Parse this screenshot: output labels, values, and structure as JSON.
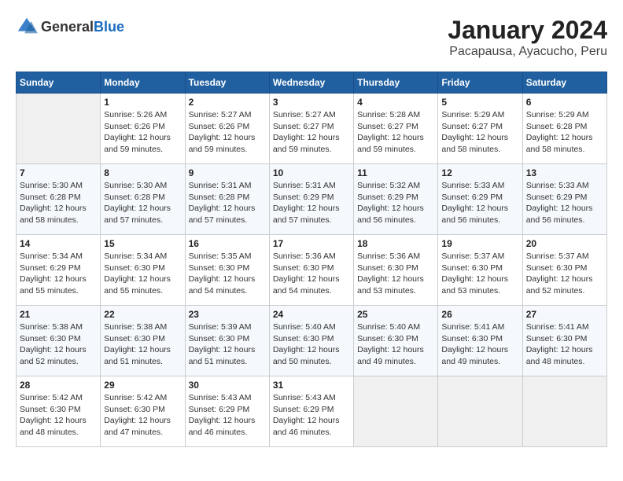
{
  "header": {
    "logo_general": "General",
    "logo_blue": "Blue",
    "title": "January 2024",
    "location": "Pacapausa, Ayacucho, Peru"
  },
  "weekdays": [
    "Sunday",
    "Monday",
    "Tuesday",
    "Wednesday",
    "Thursday",
    "Friday",
    "Saturday"
  ],
  "weeks": [
    [
      {
        "day": "",
        "empty": true
      },
      {
        "day": "1",
        "sunrise": "Sunrise: 5:26 AM",
        "sunset": "Sunset: 6:26 PM",
        "daylight": "Daylight: 12 hours and 59 minutes."
      },
      {
        "day": "2",
        "sunrise": "Sunrise: 5:27 AM",
        "sunset": "Sunset: 6:26 PM",
        "daylight": "Daylight: 12 hours and 59 minutes."
      },
      {
        "day": "3",
        "sunrise": "Sunrise: 5:27 AM",
        "sunset": "Sunset: 6:27 PM",
        "daylight": "Daylight: 12 hours and 59 minutes."
      },
      {
        "day": "4",
        "sunrise": "Sunrise: 5:28 AM",
        "sunset": "Sunset: 6:27 PM",
        "daylight": "Daylight: 12 hours and 59 minutes."
      },
      {
        "day": "5",
        "sunrise": "Sunrise: 5:29 AM",
        "sunset": "Sunset: 6:27 PM",
        "daylight": "Daylight: 12 hours and 58 minutes."
      },
      {
        "day": "6",
        "sunrise": "Sunrise: 5:29 AM",
        "sunset": "Sunset: 6:28 PM",
        "daylight": "Daylight: 12 hours and 58 minutes."
      }
    ],
    [
      {
        "day": "7",
        "sunrise": "Sunrise: 5:30 AM",
        "sunset": "Sunset: 6:28 PM",
        "daylight": "Daylight: 12 hours and 58 minutes."
      },
      {
        "day": "8",
        "sunrise": "Sunrise: 5:30 AM",
        "sunset": "Sunset: 6:28 PM",
        "daylight": "Daylight: 12 hours and 57 minutes."
      },
      {
        "day": "9",
        "sunrise": "Sunrise: 5:31 AM",
        "sunset": "Sunset: 6:28 PM",
        "daylight": "Daylight: 12 hours and 57 minutes."
      },
      {
        "day": "10",
        "sunrise": "Sunrise: 5:31 AM",
        "sunset": "Sunset: 6:29 PM",
        "daylight": "Daylight: 12 hours and 57 minutes."
      },
      {
        "day": "11",
        "sunrise": "Sunrise: 5:32 AM",
        "sunset": "Sunset: 6:29 PM",
        "daylight": "Daylight: 12 hours and 56 minutes."
      },
      {
        "day": "12",
        "sunrise": "Sunrise: 5:33 AM",
        "sunset": "Sunset: 6:29 PM",
        "daylight": "Daylight: 12 hours and 56 minutes."
      },
      {
        "day": "13",
        "sunrise": "Sunrise: 5:33 AM",
        "sunset": "Sunset: 6:29 PM",
        "daylight": "Daylight: 12 hours and 56 minutes."
      }
    ],
    [
      {
        "day": "14",
        "sunrise": "Sunrise: 5:34 AM",
        "sunset": "Sunset: 6:29 PM",
        "daylight": "Daylight: 12 hours and 55 minutes."
      },
      {
        "day": "15",
        "sunrise": "Sunrise: 5:34 AM",
        "sunset": "Sunset: 6:30 PM",
        "daylight": "Daylight: 12 hours and 55 minutes."
      },
      {
        "day": "16",
        "sunrise": "Sunrise: 5:35 AM",
        "sunset": "Sunset: 6:30 PM",
        "daylight": "Daylight: 12 hours and 54 minutes."
      },
      {
        "day": "17",
        "sunrise": "Sunrise: 5:36 AM",
        "sunset": "Sunset: 6:30 PM",
        "daylight": "Daylight: 12 hours and 54 minutes."
      },
      {
        "day": "18",
        "sunrise": "Sunrise: 5:36 AM",
        "sunset": "Sunset: 6:30 PM",
        "daylight": "Daylight: 12 hours and 53 minutes."
      },
      {
        "day": "19",
        "sunrise": "Sunrise: 5:37 AM",
        "sunset": "Sunset: 6:30 PM",
        "daylight": "Daylight: 12 hours and 53 minutes."
      },
      {
        "day": "20",
        "sunrise": "Sunrise: 5:37 AM",
        "sunset": "Sunset: 6:30 PM",
        "daylight": "Daylight: 12 hours and 52 minutes."
      }
    ],
    [
      {
        "day": "21",
        "sunrise": "Sunrise: 5:38 AM",
        "sunset": "Sunset: 6:30 PM",
        "daylight": "Daylight: 12 hours and 52 minutes."
      },
      {
        "day": "22",
        "sunrise": "Sunrise: 5:38 AM",
        "sunset": "Sunset: 6:30 PM",
        "daylight": "Daylight: 12 hours and 51 minutes."
      },
      {
        "day": "23",
        "sunrise": "Sunrise: 5:39 AM",
        "sunset": "Sunset: 6:30 PM",
        "daylight": "Daylight: 12 hours and 51 minutes."
      },
      {
        "day": "24",
        "sunrise": "Sunrise: 5:40 AM",
        "sunset": "Sunset: 6:30 PM",
        "daylight": "Daylight: 12 hours and 50 minutes."
      },
      {
        "day": "25",
        "sunrise": "Sunrise: 5:40 AM",
        "sunset": "Sunset: 6:30 PM",
        "daylight": "Daylight: 12 hours and 49 minutes."
      },
      {
        "day": "26",
        "sunrise": "Sunrise: 5:41 AM",
        "sunset": "Sunset: 6:30 PM",
        "daylight": "Daylight: 12 hours and 49 minutes."
      },
      {
        "day": "27",
        "sunrise": "Sunrise: 5:41 AM",
        "sunset": "Sunset: 6:30 PM",
        "daylight": "Daylight: 12 hours and 48 minutes."
      }
    ],
    [
      {
        "day": "28",
        "sunrise": "Sunrise: 5:42 AM",
        "sunset": "Sunset: 6:30 PM",
        "daylight": "Daylight: 12 hours and 48 minutes."
      },
      {
        "day": "29",
        "sunrise": "Sunrise: 5:42 AM",
        "sunset": "Sunset: 6:30 PM",
        "daylight": "Daylight: 12 hours and 47 minutes."
      },
      {
        "day": "30",
        "sunrise": "Sunrise: 5:43 AM",
        "sunset": "Sunset: 6:29 PM",
        "daylight": "Daylight: 12 hours and 46 minutes."
      },
      {
        "day": "31",
        "sunrise": "Sunrise: 5:43 AM",
        "sunset": "Sunset: 6:29 PM",
        "daylight": "Daylight: 12 hours and 46 minutes."
      },
      {
        "day": "",
        "empty": true
      },
      {
        "day": "",
        "empty": true
      },
      {
        "day": "",
        "empty": true
      }
    ]
  ]
}
